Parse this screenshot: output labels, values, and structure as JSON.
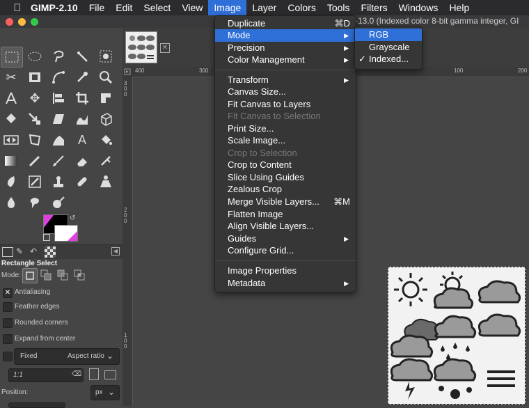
{
  "menubar": {
    "app": "GIMP-2.10",
    "items": [
      "File",
      "Edit",
      "Select",
      "View",
      "Image",
      "Layer",
      "Colors",
      "Tools",
      "Filters",
      "Windows",
      "Help"
    ],
    "active": "Image"
  },
  "window": {
    "title_fragment": "-13.0 (Indexed color 8-bit gamma integer, GI"
  },
  "image_menu": [
    {
      "label": "Duplicate",
      "shortcut": "⌘D"
    },
    {
      "label": "Mode",
      "submenu": true
    },
    {
      "label": "Precision",
      "submenu": true
    },
    {
      "label": "Color Management",
      "submenu": true
    },
    {
      "label": "Transform",
      "submenu": true
    },
    {
      "label": "Canvas Size..."
    },
    {
      "label": "Fit Canvas to Layers"
    },
    {
      "label": "Fit Canvas to Selection",
      "disabled": true
    },
    {
      "label": "Print Size..."
    },
    {
      "label": "Scale Image..."
    },
    {
      "label": "Crop to Selection",
      "disabled": true
    },
    {
      "label": "Crop to Content"
    },
    {
      "label": "Slice Using Guides"
    },
    {
      "label": "Zealous Crop"
    },
    {
      "label": "Merge Visible Layers...",
      "shortcut": "⌘M"
    },
    {
      "label": "Flatten Image"
    },
    {
      "label": "Align Visible Layers..."
    },
    {
      "label": "Guides",
      "submenu": true
    },
    {
      "label": "Configure Grid..."
    },
    {
      "label": "Image Properties"
    },
    {
      "label": "Metadata",
      "submenu": true
    }
  ],
  "mode_submenu": [
    {
      "label": "RGB"
    },
    {
      "label": "Grayscale"
    },
    {
      "label": "Indexed...",
      "checked": true
    }
  ],
  "tool_options": {
    "title": "Rectangle Select",
    "mode_label": "Mode:",
    "antialiasing": "Antialiasing",
    "feather": "Feather edges",
    "rounded": "Rounded corners",
    "expand": "Expand from center",
    "fixed": "Fixed",
    "fixed_option": "Aspect ratio",
    "ratio": "1:1",
    "position_label": "Position:",
    "unit": "px"
  },
  "rulers": {
    "h": [
      "400",
      "300",
      "100",
      "200"
    ],
    "v": [
      "300",
      "200",
      "100"
    ]
  },
  "colors": {
    "menu_bg": "#363636",
    "highlight": "#2f6fd8",
    "fg_swatch": "#000000",
    "bg_swatch": "#ffffff",
    "accent_magenta": "#e040e0"
  }
}
